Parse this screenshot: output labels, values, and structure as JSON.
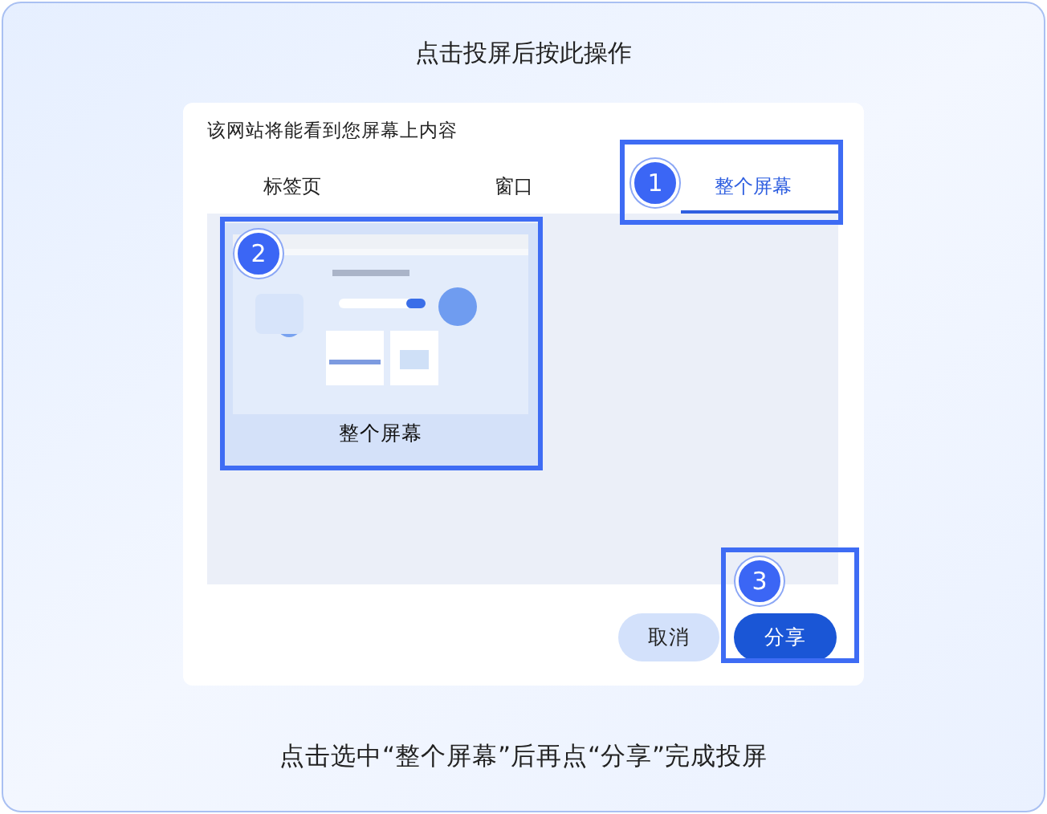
{
  "title": "点击投屏后按此操作",
  "dialog": {
    "heading": "该网站将能看到您屏幕上内容",
    "tabs": [
      {
        "label": "标签页",
        "selected": false
      },
      {
        "label": "窗口",
        "selected": false
      },
      {
        "label": "整个屏幕",
        "selected": true
      }
    ],
    "sources": [
      {
        "kind": "picture",
        "label": "整个屏幕",
        "selected": true
      }
    ],
    "buttons": [
      {
        "label": "取消",
        "kind": "secondary"
      },
      {
        "label": "分享",
        "kind": "primary"
      }
    ]
  },
  "steps": [
    "1",
    "2",
    "3"
  ],
  "instruction": "点击选中“整个屏幕”后再点“分享”完成投屏"
}
